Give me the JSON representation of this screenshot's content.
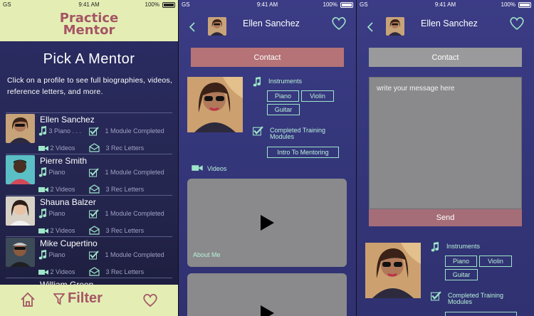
{
  "status": {
    "carrier": "GS",
    "time": "9:41 AM",
    "battery": "100%"
  },
  "list_screen": {
    "app_title_line1": "Practice",
    "app_title_line2": "Mentor",
    "heading": "Pick A Mentor",
    "description": "Click on a profile to see full biographies, videos, reference letters, and more.",
    "mentors": [
      {
        "name": "Ellen Sanchez",
        "instruments": "3 Piano . . .",
        "modules": "1 Module Completed",
        "videos": "2 Videos",
        "letters": "3 Rec Letters"
      },
      {
        "name": "Pierre Smith",
        "instruments": "Piano",
        "modules": "1 Module Completed",
        "videos": "2 Videos",
        "letters": "3 Rec Letters"
      },
      {
        "name": "Shauna Balzer",
        "instruments": "Piano",
        "modules": "1 Module Completed",
        "videos": "2 Videos",
        "letters": "3 Rec Letters"
      },
      {
        "name": "Mike Cupertino",
        "instruments": "Piano",
        "modules": "1 Module Completed",
        "videos": "2 Videos",
        "letters": "3 Rec Letters"
      },
      {
        "name": "William Green"
      }
    ],
    "footer": {
      "filter_label": "Filter",
      "home_icon": "home-icon",
      "filter_icon": "funnel-icon",
      "heart_icon": "heart-icon"
    }
  },
  "profile_screen": {
    "mentor_name": "Ellen Sanchez",
    "contact_label": "Contact",
    "instruments_title": "Instruments",
    "instruments": [
      "Piano",
      "Violin",
      "Guitar"
    ],
    "training_title": "Completed Training Modules",
    "training_modules": [
      "Intro To Mentoring"
    ],
    "videos_title": "Videos",
    "video_cards": [
      {
        "label": "About Me"
      },
      {
        "label": ""
      }
    ]
  },
  "contact_screen": {
    "mentor_name": "Ellen Sanchez",
    "contact_label": "Contact",
    "message_placeholder": "write your message here",
    "send_label": "Send",
    "instruments_title": "Instruments",
    "instruments": [
      "Piano",
      "Violin",
      "Guitar"
    ],
    "training_title": "Completed Training Modules"
  },
  "colors": {
    "accent_pink": "#a55565",
    "header_green": "#e4eeb4",
    "mint_text": "#b9f0d8",
    "contact_button_pink": "#b57377",
    "contact_button_gray": "#9a9a9c"
  }
}
